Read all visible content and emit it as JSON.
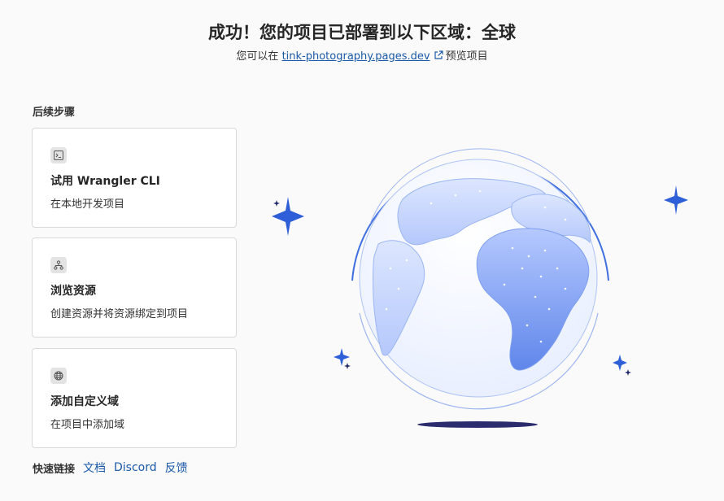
{
  "header": {
    "title": "成功！您的项目已部署到以下区域：全球",
    "subtitle_prefix": "您可以在",
    "project_url": "tink-photography.pages.dev",
    "subtitle_suffix": "预览项目"
  },
  "next_steps": {
    "heading": "后续步骤",
    "cards": [
      {
        "icon": "terminal-icon",
        "title": "试用 Wrangler CLI",
        "description": "在本地开发项目"
      },
      {
        "icon": "resource-tree-icon",
        "title": "浏览资源",
        "description": "创建资源并将资源绑定到项目"
      },
      {
        "icon": "globe-icon",
        "title": "添加自定义域",
        "description": "在项目中添加域"
      }
    ]
  },
  "quick_links": {
    "label": "快速链接",
    "links": [
      "文档",
      "Discord",
      "反馈"
    ]
  },
  "colors": {
    "link": "#1a59a8",
    "globe_blue": "#3f6fe0",
    "globe_light": "#c9d8ff",
    "sparkle": "#2f5fd8",
    "shadow": "#2b2c6e"
  }
}
